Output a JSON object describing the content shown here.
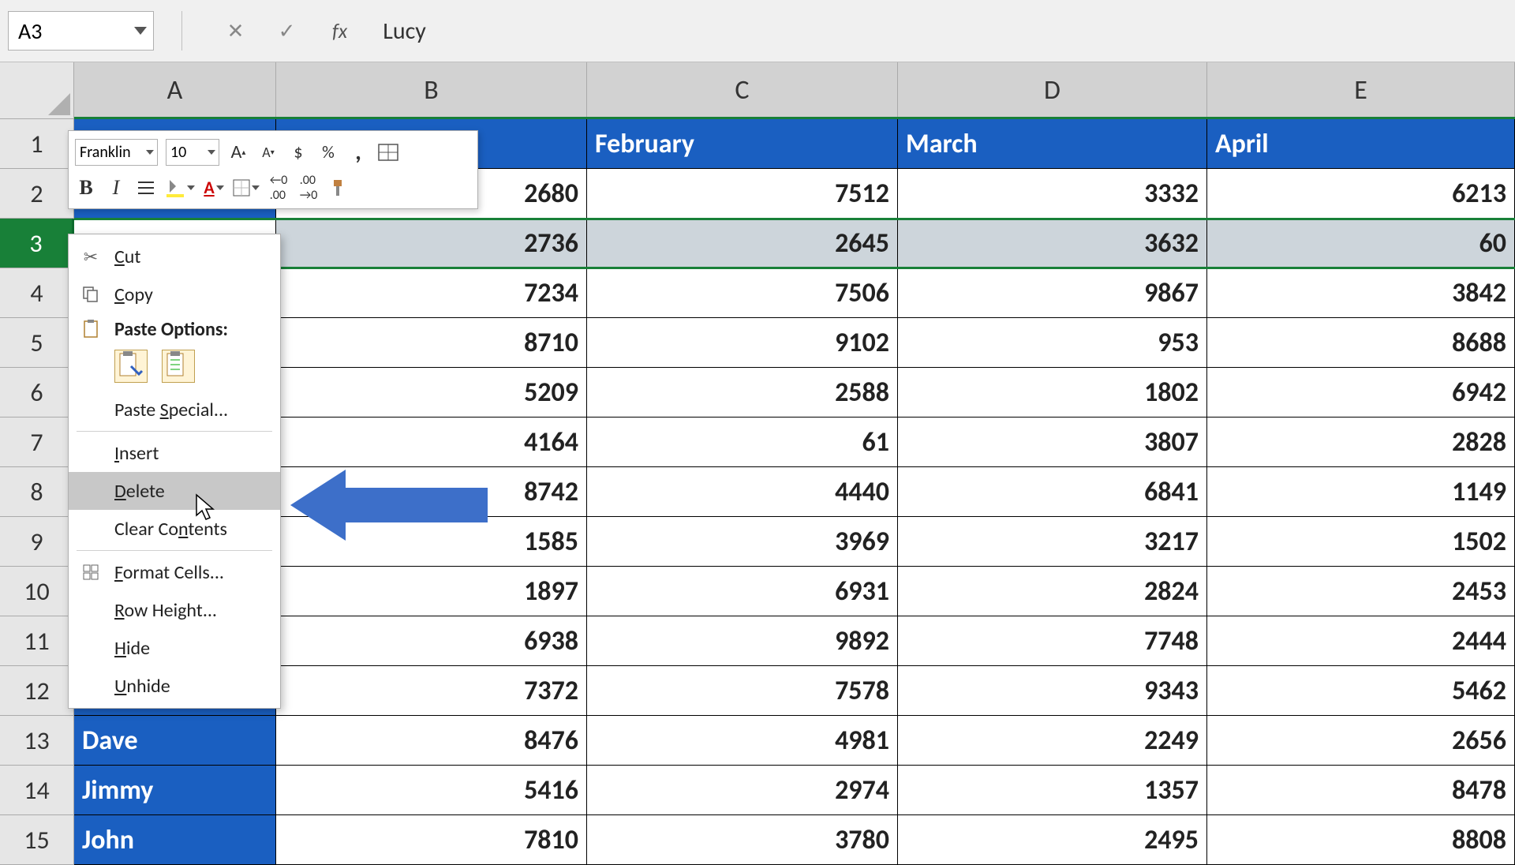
{
  "formula_bar": {
    "name_box": "A3",
    "cancel": "✕",
    "enter": "✓",
    "fx": "fx",
    "value": "Lucy"
  },
  "columns": [
    "A",
    "B",
    "C",
    "D",
    "E"
  ],
  "row_numbers": [
    1,
    2,
    3,
    4,
    5,
    6,
    7,
    8,
    9,
    10,
    11,
    12,
    13,
    14,
    15
  ],
  "headers": {
    "c": "February",
    "d": "March",
    "e": "April"
  },
  "data": {
    "r2": {
      "b": "2680",
      "c": "7512",
      "d": "3332",
      "e": "6213"
    },
    "r3": {
      "b": "2736",
      "c": "2645",
      "d": "3632",
      "e": "60"
    },
    "r4": {
      "b": "7234",
      "c": "7506",
      "d": "9867",
      "e": "3842"
    },
    "r5": {
      "b": "8710",
      "c": "9102",
      "d": "953",
      "e": "8688"
    },
    "r6": {
      "b": "5209",
      "c": "2588",
      "d": "1802",
      "e": "6942"
    },
    "r7": {
      "b": "4164",
      "c": "61",
      "d": "3807",
      "e": "2828"
    },
    "r8": {
      "b": "8742",
      "c": "4440",
      "d": "6841",
      "e": "1149"
    },
    "r9": {
      "b": "1585",
      "c": "3969",
      "d": "3217",
      "e": "1502"
    },
    "r10": {
      "b": "1897",
      "c": "6931",
      "d": "2824",
      "e": "2453"
    },
    "r11": {
      "b": "6938",
      "c": "9892",
      "d": "7748",
      "e": "2444"
    },
    "r12": {
      "b": "7372",
      "c": "7578",
      "d": "9343",
      "e": "5462"
    },
    "r13": {
      "a": "Dave",
      "b": "8476",
      "c": "4981",
      "d": "2249",
      "e": "2656"
    },
    "r14": {
      "a": "Jimmy",
      "b": "5416",
      "c": "2974",
      "d": "1357",
      "e": "8478"
    },
    "r15": {
      "a": "John",
      "b": "7810",
      "c": "3780",
      "d": "2495",
      "e": "8808"
    }
  },
  "mini_toolbar": {
    "font": "Franklin",
    "size": "10",
    "inc_font": "A",
    "dec_font": "A",
    "dollar": "$",
    "percent": "%",
    "comma": ",",
    "bold": "B",
    "italic": "I"
  },
  "context_menu": {
    "cut": "Cut",
    "copy": "Copy",
    "paste_options": "Paste Options:",
    "paste_special": "Paste Special...",
    "insert": "Insert",
    "delete": "Delete",
    "clear_contents": "Clear Contents",
    "format_cells": "Format Cells...",
    "row_height": "Row Height...",
    "hide": "Hide",
    "unhide": "Unhide"
  }
}
